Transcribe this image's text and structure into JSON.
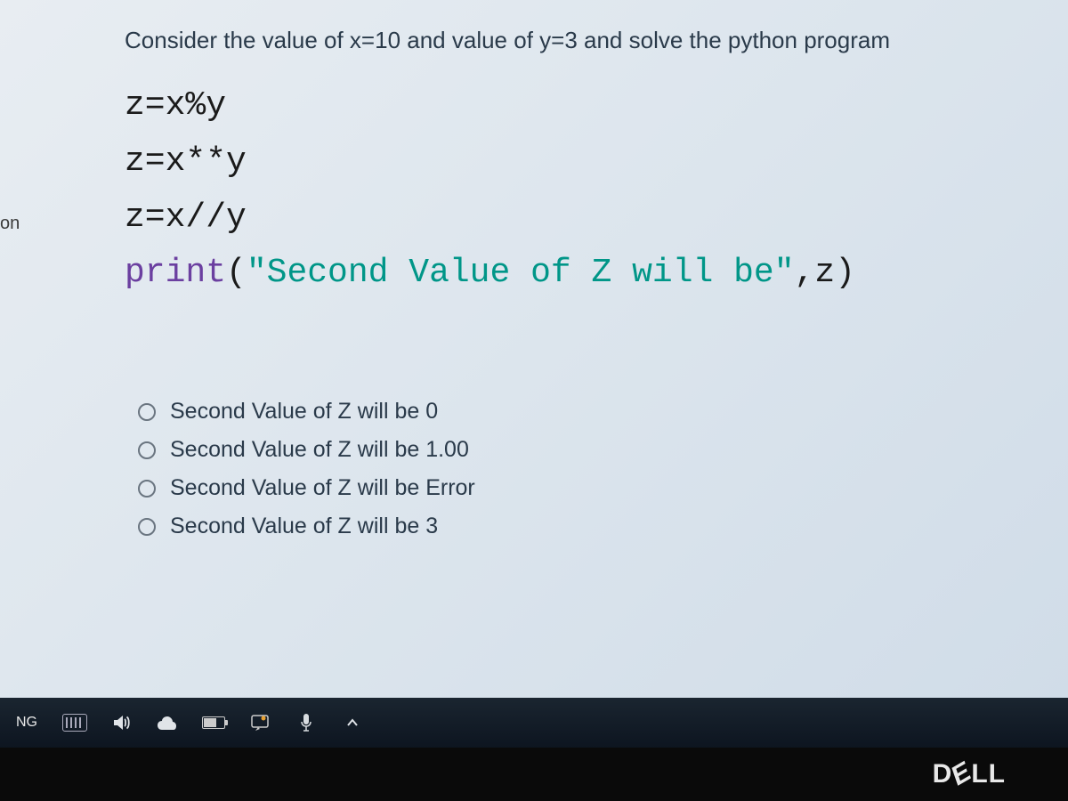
{
  "left_tab": "on",
  "question": "Consider the value of x=10 and value of y=3 and solve the python program",
  "code": {
    "line1": "z=x%y",
    "line2": "z=x**y",
    "line3": "z=x//y",
    "print_keyword": "print",
    "print_open": "(",
    "print_string": "\"Second Value of Z will be\"",
    "print_close": ",z)"
  },
  "options": [
    "Second Value of Z will be 0",
    "Second Value of Z will be 1.00",
    "Second Value of Z will be Error",
    "Second Value of Z will be 3"
  ],
  "taskbar": {
    "language": "NG"
  },
  "bezel": {
    "brand": "DELL"
  }
}
